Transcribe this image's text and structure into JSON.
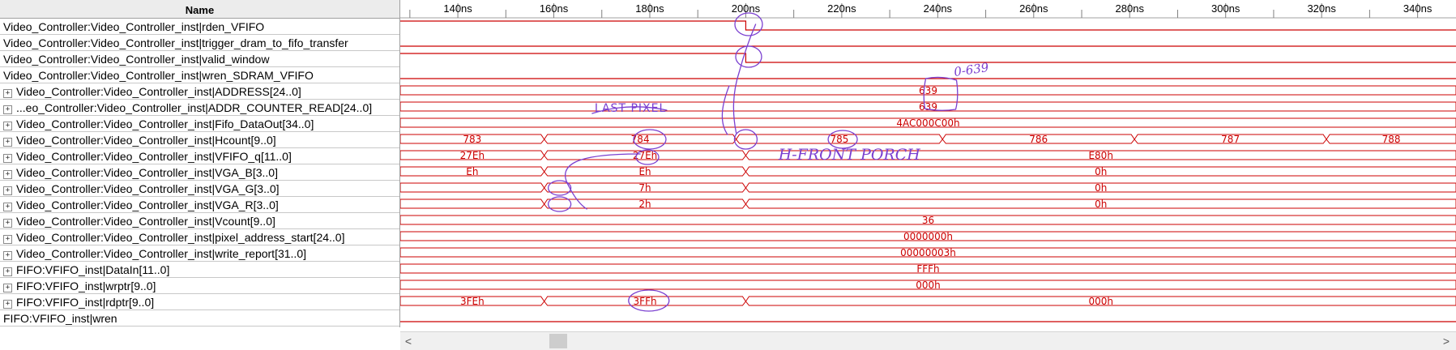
{
  "names_header": "Name",
  "signals": [
    {
      "name": "Video_Controller:Video_Controller_inst|rden_VFIFO",
      "expandable": false
    },
    {
      "name": "Video_Controller:Video_Controller_inst|trigger_dram_to_fifo_transfer",
      "expandable": false
    },
    {
      "name": "Video_Controller:Video_Controller_inst|valid_window",
      "expandable": false
    },
    {
      "name": "Video_Controller:Video_Controller_inst|wren_SDRAM_VFIFO",
      "expandable": false
    },
    {
      "name": "Video_Controller:Video_Controller_inst|ADDRESS[24..0]",
      "expandable": true
    },
    {
      "name": "...eo_Controller:Video_Controller_inst|ADDR_COUNTER_READ[24..0]",
      "expandable": true
    },
    {
      "name": "Video_Controller:Video_Controller_inst|Fifo_DataOut[34..0]",
      "expandable": true
    },
    {
      "name": "Video_Controller:Video_Controller_inst|Hcount[9..0]",
      "expandable": true
    },
    {
      "name": "Video_Controller:Video_Controller_inst|VFIFO_q[11..0]",
      "expandable": true
    },
    {
      "name": "Video_Controller:Video_Controller_inst|VGA_B[3..0]",
      "expandable": true
    },
    {
      "name": "Video_Controller:Video_Controller_inst|VGA_G[3..0]",
      "expandable": true
    },
    {
      "name": "Video_Controller:Video_Controller_inst|VGA_R[3..0]",
      "expandable": true
    },
    {
      "name": "Video_Controller:Video_Controller_inst|Vcount[9..0]",
      "expandable": true
    },
    {
      "name": "Video_Controller:Video_Controller_inst|pixel_address_start[24..0]",
      "expandable": true
    },
    {
      "name": "Video_Controller:Video_Controller_inst|write_report[31..0]",
      "expandable": true
    },
    {
      "name": "FIFO:VFIFO_inst|DataIn[11..0]",
      "expandable": true
    },
    {
      "name": "FIFO:VFIFO_inst|wrptr[9..0]",
      "expandable": true
    },
    {
      "name": "FIFO:VFIFO_inst|rdptr[9..0]",
      "expandable": true
    },
    {
      "name": "FIFO:VFIFO_inst|wren",
      "expandable": false
    }
  ],
  "expand_glyph": "+",
  "timeline": {
    "labels": [
      "140ns",
      "160ns",
      "180ns",
      "200ns",
      "220ns",
      "240ns",
      "260ns",
      "280ns",
      "300ns",
      "320ns",
      "340ns"
    ],
    "range_ns": [
      128,
      348
    ]
  },
  "waves": [
    {
      "type": "digital",
      "segments": [
        [
          128,
          200,
          1
        ],
        [
          200,
          348,
          0
        ]
      ]
    },
    {
      "type": "digital",
      "segments": [
        [
          128,
          348,
          0
        ]
      ]
    },
    {
      "type": "digital",
      "segments": [
        [
          128,
          200,
          1
        ],
        [
          200,
          348,
          0
        ]
      ]
    },
    {
      "type": "digital",
      "segments": [
        [
          128,
          348,
          0
        ]
      ]
    },
    {
      "type": "bus",
      "segments": [
        [
          128,
          348,
          "639"
        ]
      ]
    },
    {
      "type": "bus",
      "segments": [
        [
          128,
          348,
          "639"
        ]
      ]
    },
    {
      "type": "bus",
      "segments": [
        [
          128,
          348,
          "4AC000C00h"
        ]
      ]
    },
    {
      "type": "bus",
      "segments": [
        [
          128,
          158,
          "783"
        ],
        [
          158,
          198,
          "784"
        ],
        [
          198,
          241,
          "785"
        ],
        [
          241,
          281,
          "786"
        ],
        [
          281,
          321,
          "787"
        ],
        [
          321,
          348,
          "788"
        ]
      ]
    },
    {
      "type": "bus",
      "segments": [
        [
          128,
          158,
          "27Eh"
        ],
        [
          158,
          200,
          "27Eh"
        ],
        [
          200,
          348,
          "E80h"
        ]
      ]
    },
    {
      "type": "bus",
      "segments": [
        [
          128,
          158,
          "Eh"
        ],
        [
          158,
          200,
          "Eh"
        ],
        [
          200,
          348,
          "0h"
        ]
      ]
    },
    {
      "type": "bus",
      "segments": [
        [
          128,
          158,
          ""
        ],
        [
          158,
          200,
          "7h"
        ],
        [
          200,
          348,
          "0h"
        ]
      ]
    },
    {
      "type": "bus",
      "segments": [
        [
          128,
          158,
          ""
        ],
        [
          158,
          200,
          "2h"
        ],
        [
          200,
          348,
          "0h"
        ]
      ]
    },
    {
      "type": "bus",
      "segments": [
        [
          128,
          348,
          "36"
        ]
      ]
    },
    {
      "type": "bus",
      "segments": [
        [
          128,
          348,
          "0000000h"
        ]
      ]
    },
    {
      "type": "bus",
      "segments": [
        [
          128,
          348,
          "00000003h"
        ]
      ]
    },
    {
      "type": "bus",
      "segments": [
        [
          128,
          348,
          "FFFh"
        ]
      ]
    },
    {
      "type": "bus",
      "segments": [
        [
          128,
          348,
          "000h"
        ]
      ]
    },
    {
      "type": "bus",
      "segments": [
        [
          128,
          158,
          "3FEh"
        ],
        [
          158,
          200,
          "3FFh"
        ],
        [
          200,
          348,
          "000h"
        ]
      ]
    },
    {
      "type": "digital",
      "segments": [
        [
          128,
          348,
          0
        ]
      ]
    }
  ],
  "annotations": {
    "last_pixel": "LAST PIXEL",
    "front_porch": "H-FRONT PORCH",
    "range_note": "0-639"
  },
  "colors": {
    "wave": "#cc0000",
    "annotation": "#7a3fd0",
    "tick": "#808080"
  },
  "scrollbar": {
    "left_arrow": "<",
    "right_arrow": ">"
  }
}
